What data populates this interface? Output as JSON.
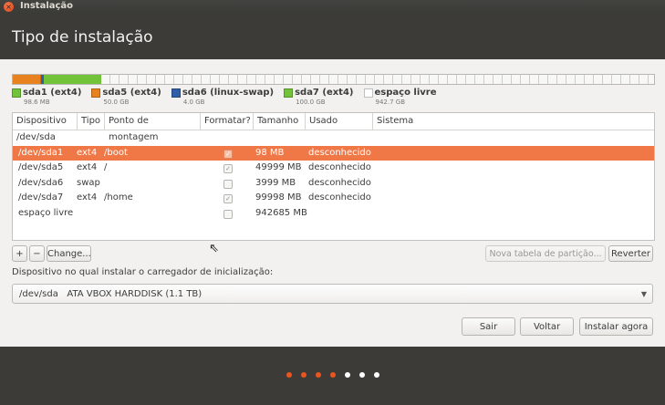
{
  "window": {
    "title": "Instalação"
  },
  "header": {
    "title": "Tipo de instalação"
  },
  "partition_bar": {
    "segments": [
      {
        "name": "sda5 (ext4)",
        "color": "#e7821f",
        "fraction": 0.0455
      },
      {
        "name": "sda6 (linux-swap)",
        "color": "#2f5fa6",
        "fraction": 0.0036
      },
      {
        "name": "sda7 (ext4)",
        "color": "#73c33a",
        "fraction": 0.091
      },
      {
        "name": "espaço livre",
        "color": "#f7f7f6",
        "fraction": 0.8599
      }
    ]
  },
  "legend": [
    {
      "name": "sda1 (ext4)",
      "size": "98.6 MB",
      "color": "#73c33a"
    },
    {
      "name": "sda5 (ext4)",
      "size": "50.0 GB",
      "color": "#e7821f"
    },
    {
      "name": "sda6 (linux-swap)",
      "size": "4.0 GB",
      "color": "#2f5fa6"
    },
    {
      "name": "sda7 (ext4)",
      "size": "100.0 GB",
      "color": "#73c33a"
    },
    {
      "name": "espaço livre",
      "size": "942.7 GB",
      "color": "#ffffff"
    }
  ],
  "table": {
    "columns": [
      "Dispositivo",
      "Tipo",
      "Ponto de montagem",
      "Formatar?",
      "Tamanho",
      "Usado",
      "Sistema"
    ],
    "group": "/dev/sda",
    "rows": [
      {
        "device": "/dev/sda1",
        "type": "ext4",
        "mount": "/boot",
        "format": true,
        "size": "98 MB",
        "used": "desconhecido",
        "system": "",
        "selected": true
      },
      {
        "device": "/dev/sda5",
        "type": "ext4",
        "mount": "/",
        "format": true,
        "size": "49999 MB",
        "used": "desconhecido",
        "system": "",
        "selected": false
      },
      {
        "device": "/dev/sda6",
        "type": "swap",
        "mount": "",
        "format": false,
        "size": "3999 MB",
        "used": "desconhecido",
        "system": "",
        "selected": false
      },
      {
        "device": "/dev/sda7",
        "type": "ext4",
        "mount": "/home",
        "format": true,
        "size": "99998 MB",
        "used": "desconhecido",
        "system": "",
        "selected": false
      },
      {
        "device": "espaço livre",
        "type": "",
        "mount": "",
        "format": false,
        "size": "942685 MB",
        "used": "",
        "system": "",
        "selected": false
      }
    ]
  },
  "toolbar": {
    "add": "+",
    "remove": "−",
    "change": "Change...",
    "new_table": "Nova tabela de partição...",
    "revert": "Reverter"
  },
  "bootloader": {
    "label": "Dispositivo no qual instalar o carregador de inicialização:",
    "device": "/dev/sda",
    "description": "ATA VBOX HARDDISK (1.1 TB)"
  },
  "actions": {
    "quit": "Sair",
    "back": "Voltar",
    "install": "Instalar agora"
  },
  "progress": {
    "completed_steps": 4,
    "total_steps": 7,
    "active_color": "#e95420",
    "inactive_color": "#ffffff"
  }
}
